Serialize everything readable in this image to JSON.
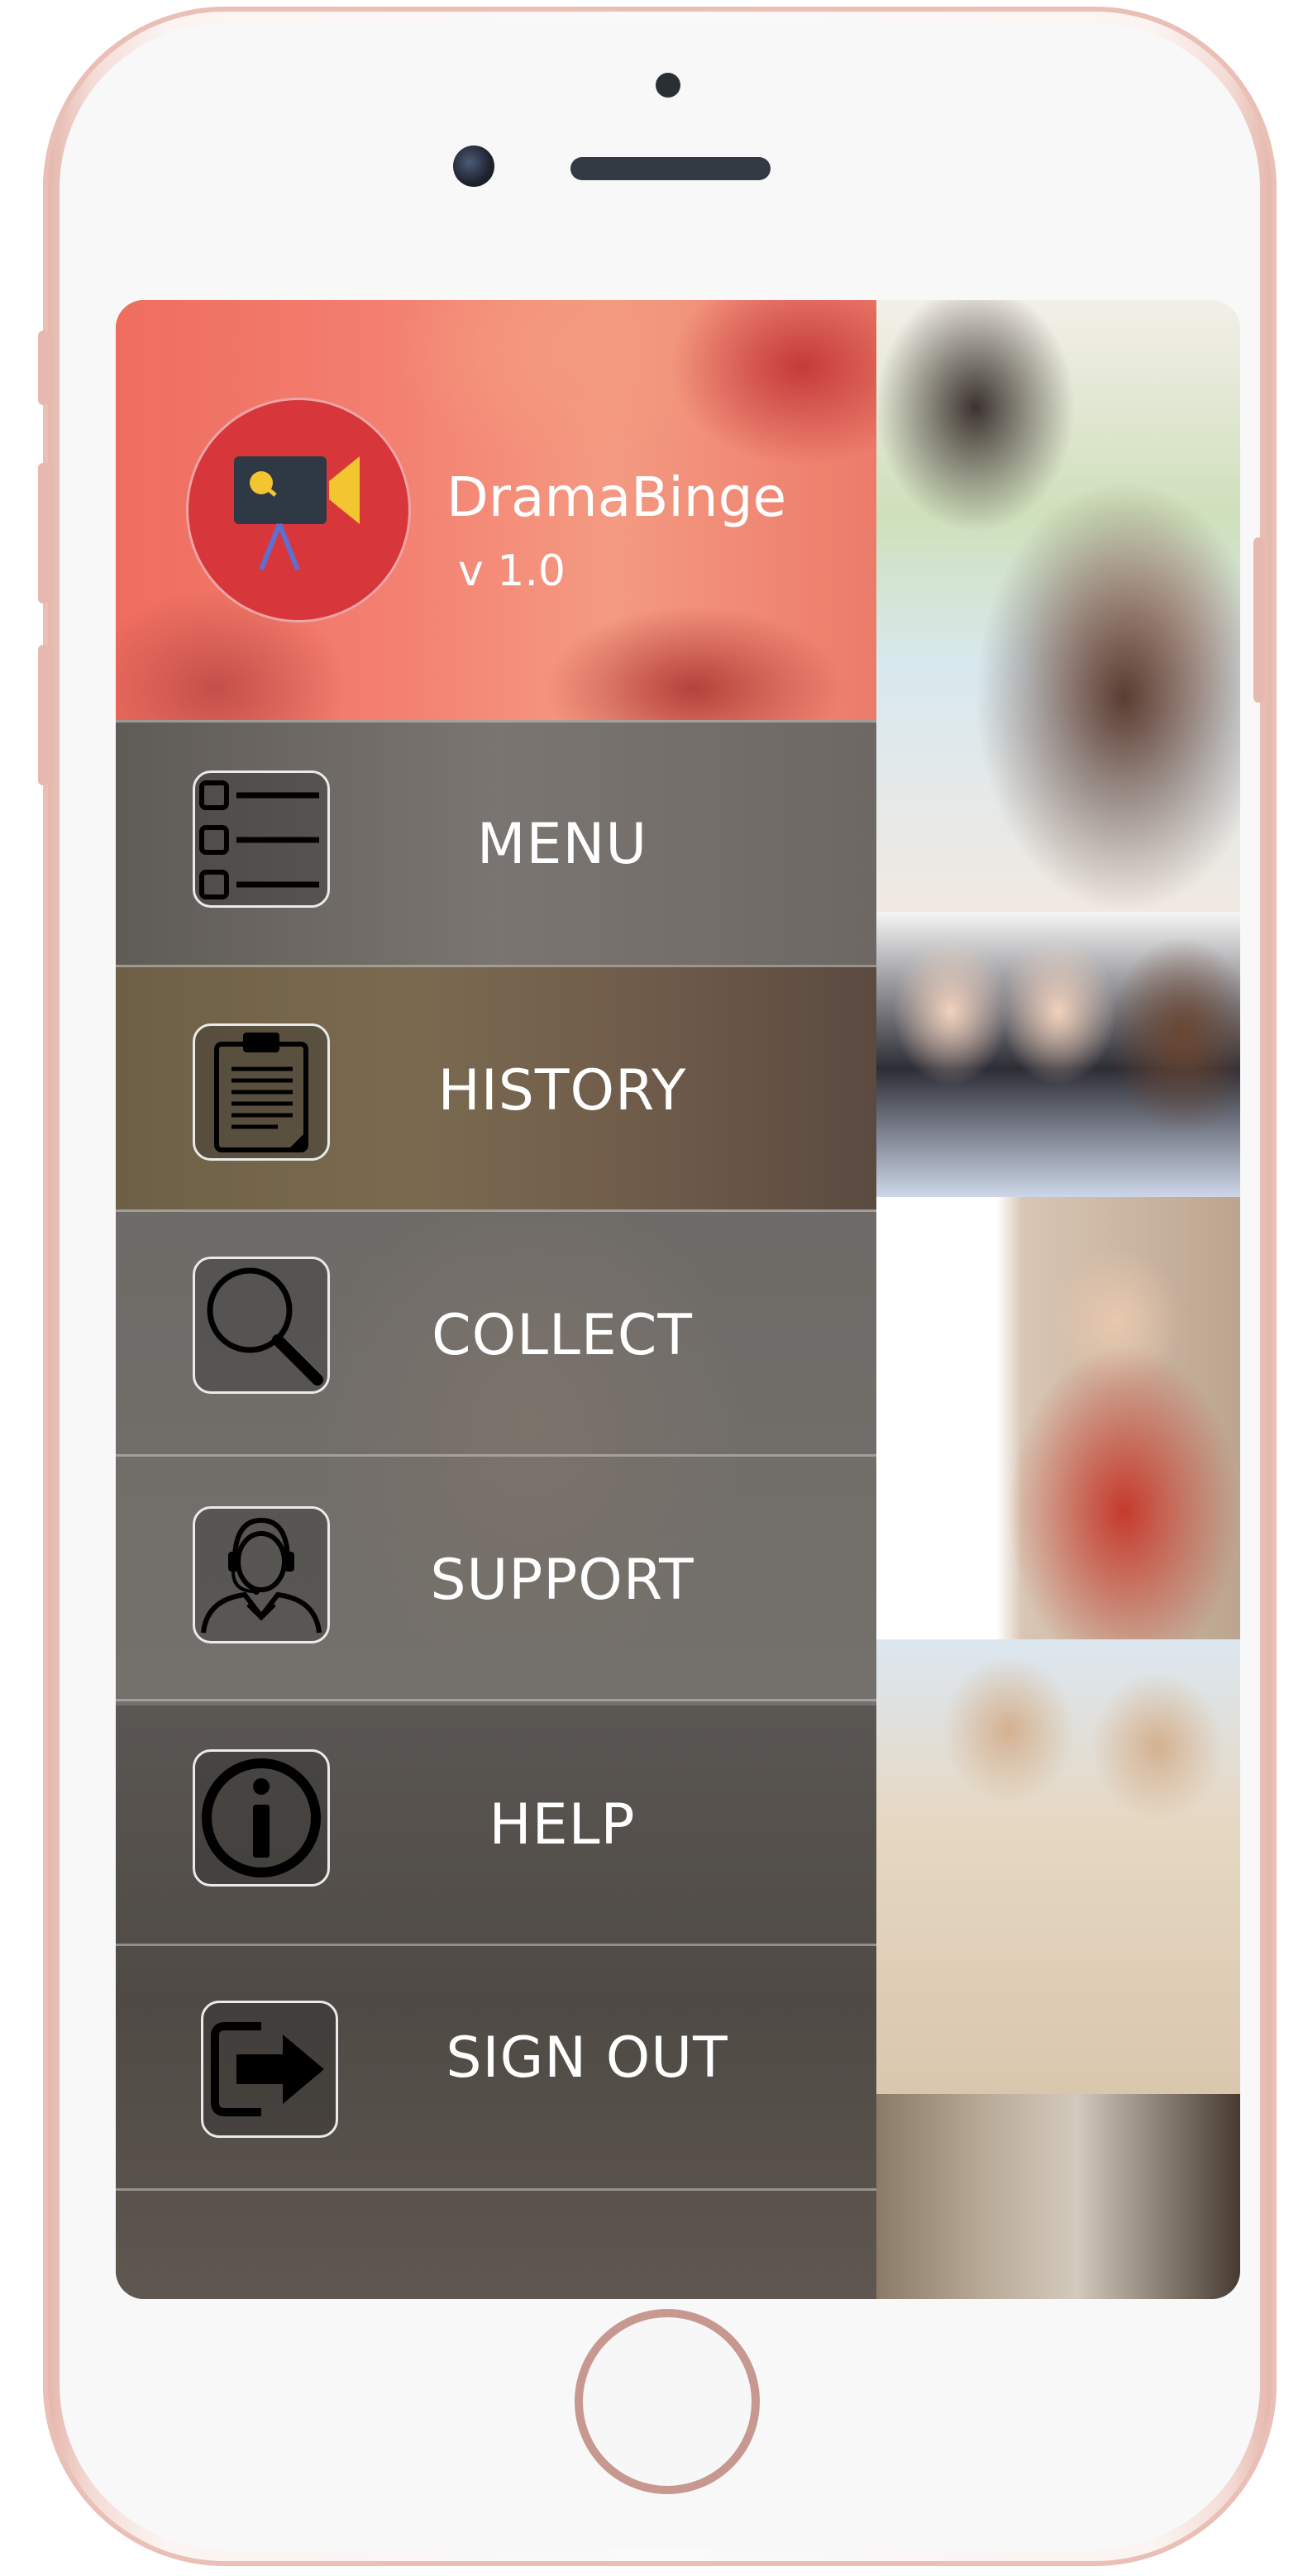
{
  "app": {
    "name": "DramaBinge",
    "version": "v 1.0"
  },
  "menu": [
    {
      "label": "MENU",
      "icon": "list-icon"
    },
    {
      "label": "HISTORY",
      "icon": "clipboard-icon"
    },
    {
      "label": "COLLECT",
      "icon": "magnifier-icon"
    },
    {
      "label": "SUPPORT",
      "icon": "support-agent-icon"
    },
    {
      "label": "HELP",
      "icon": "info-icon"
    },
    {
      "label": "SIGN OUT",
      "icon": "sign-out-arrow-icon"
    }
  ],
  "colors": {
    "header_accent": "#ef6d5f",
    "logo_circle": "#d7373b",
    "drawer_overlay": "#6a6560",
    "text": "#ffffff",
    "phone_frame": "#e3b2a8"
  }
}
